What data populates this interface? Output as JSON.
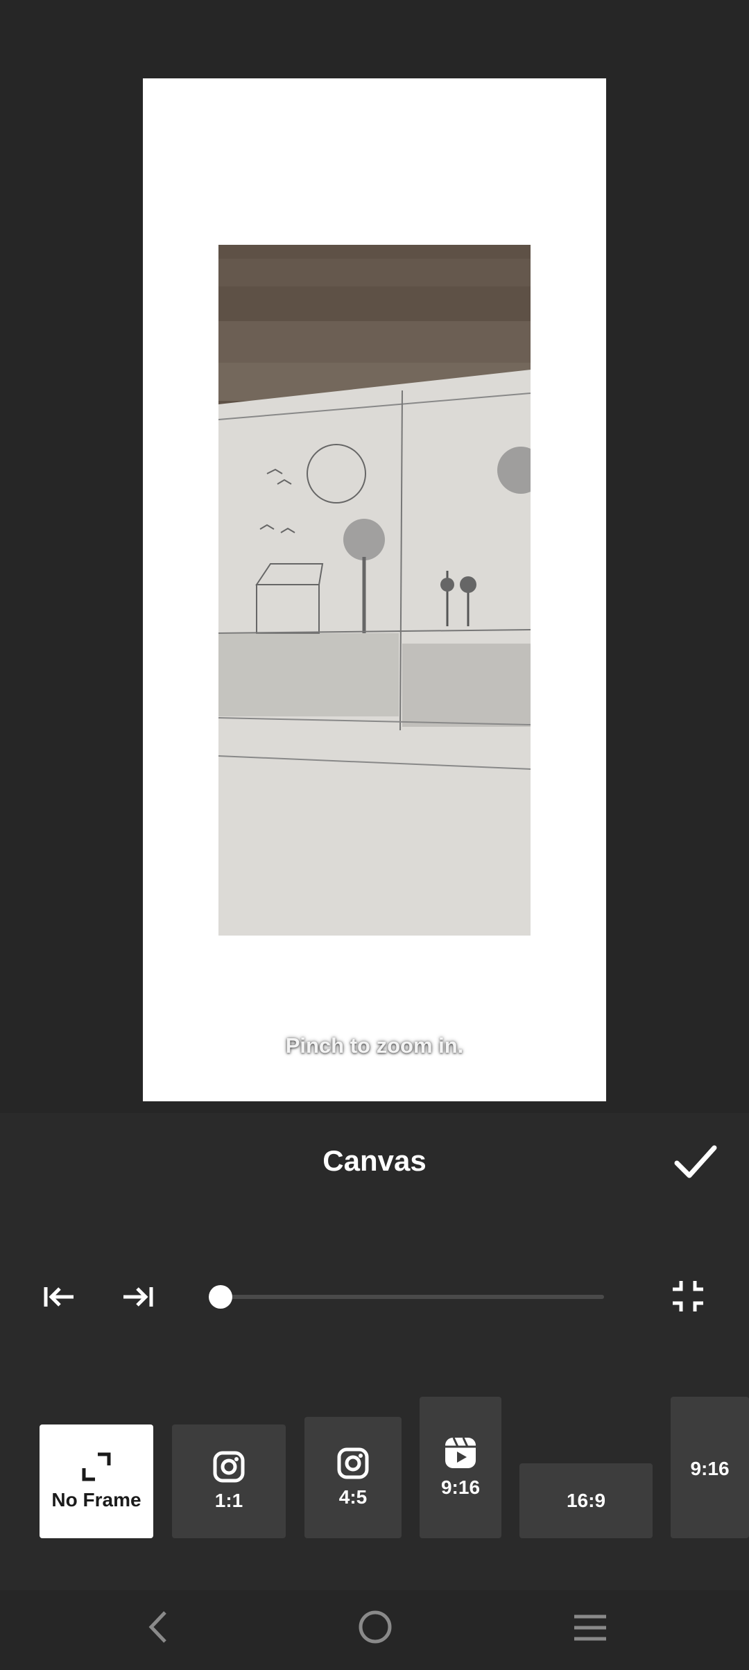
{
  "preview": {
    "hint": "Pinch to zoom in."
  },
  "panel": {
    "title": "Canvas",
    "slider_value": 0
  },
  "frames": [
    {
      "label": "No Frame",
      "icon": "expand-icon",
      "selected": true
    },
    {
      "label": "1:1",
      "icon": "instagram-icon",
      "selected": false
    },
    {
      "label": "4:5",
      "icon": "instagram-icon",
      "selected": false
    },
    {
      "label": "9:16",
      "icon": "reels-icon",
      "selected": false
    },
    {
      "label": "16:9",
      "icon": "",
      "selected": false
    },
    {
      "label": "9:16",
      "icon": "",
      "selected": false
    }
  ],
  "colors": {
    "background": "#262626",
    "panel": "#2a2a2a",
    "tile": "#3d3d3d",
    "selected_tile": "#ffffff"
  }
}
